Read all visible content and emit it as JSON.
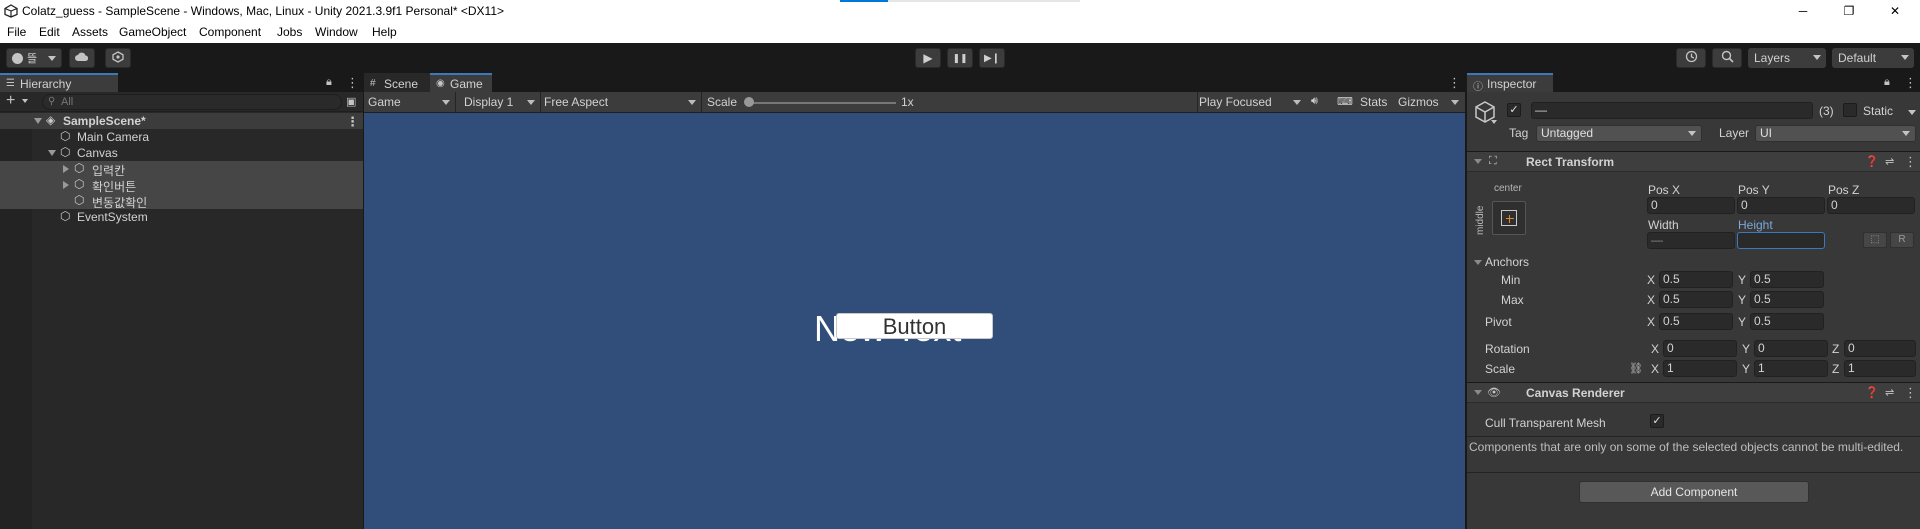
{
  "titlebar": {
    "title": "Colatz_guess - SampleScene - Windows, Mac, Linux - Unity 2021.3.9f1 Personal* <DX11>",
    "minimize": "─",
    "maximize": "❐",
    "close": "✕"
  },
  "menubar": {
    "items": [
      "File",
      "Edit",
      "Assets",
      "GameObject",
      "Component",
      "Jobs",
      "Window",
      "Help"
    ]
  },
  "toolbar": {
    "account_label": "뜰",
    "play": "▶",
    "pause": "❚❚",
    "step": "▶❙",
    "layers": "Layers",
    "layout": "Default"
  },
  "hierarchy": {
    "tab": "Hierarchy",
    "add": "+",
    "search_placeholder": "All",
    "items": [
      {
        "label": "SampleScene*"
      },
      {
        "label": "Main Camera"
      },
      {
        "label": "Canvas"
      },
      {
        "label": "입력칸"
      },
      {
        "label": "확인버튼"
      },
      {
        "label": "변동값확인"
      },
      {
        "label": "EventSystem"
      }
    ]
  },
  "gameview": {
    "tabs": [
      "Scene",
      "Game"
    ],
    "mode": "Game",
    "display": "Display 1",
    "aspect": "Free Aspect",
    "scale_label": "Scale",
    "scale_value": "1x",
    "play_mode": "Play Focused",
    "stats": "Stats",
    "gizmos": "Gizmos",
    "scene_text": "New Text",
    "button_text": "Button"
  },
  "inspector": {
    "tab": "Inspector",
    "name_value": "—",
    "count": "(3)",
    "static_label": "Static",
    "tag_label": "Tag",
    "tag_value": "Untagged",
    "layer_label": "Layer",
    "layer_value": "UI",
    "rect_transform": {
      "title": "Rect Transform",
      "anchor_h": "center",
      "anchor_v": "middle",
      "pos_x_label": "Pos X",
      "pos_x": "0",
      "pos_y_label": "Pos Y",
      "pos_y": "0",
      "pos_z_label": "Pos Z",
      "pos_z": "0",
      "width_label": "Width",
      "width": "—",
      "height_label": "Height",
      "height": "",
      "raw_button": "R",
      "anchors_label": "Anchors",
      "min_label": "Min",
      "min_x": "0.5",
      "min_y": "0.5",
      "max_label": "Max",
      "max_x": "0.5",
      "max_y": "0.5",
      "pivot_label": "Pivot",
      "pivot_x": "0.5",
      "pivot_y": "0.5",
      "rotation_label": "Rotation",
      "rot_x": "0",
      "rot_y": "0",
      "rot_z": "0",
      "scale_label": "Scale",
      "scale_x": "1",
      "scale_y": "1",
      "scale_z": "1",
      "x": "X",
      "y": "Y",
      "z": "Z"
    },
    "canvas_renderer": {
      "title": "Canvas Renderer",
      "cull_label": "Cull Transparent Mesh"
    },
    "note": "Components that are only on some of the selected objects cannot be multi-edited.",
    "add_component": "Add Component"
  },
  "colors": {
    "accent": "#3a79bb",
    "game_bg": "#314d79",
    "panel_bg": "#282828",
    "inspector_bg": "#383838"
  }
}
